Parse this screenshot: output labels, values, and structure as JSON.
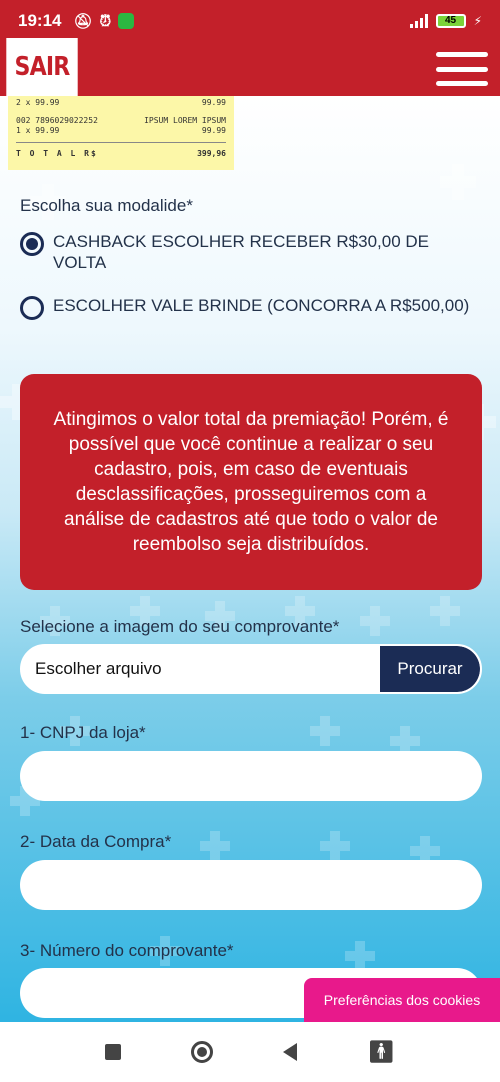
{
  "status_bar": {
    "time": "19:14",
    "battery": "45"
  },
  "header": {
    "logo_text": "SAIR",
    "brand_color": "#c3202a"
  },
  "receipt": {
    "row1_left": "2 x 99.99",
    "row1_right": "99.99",
    "row2_left": "002   7896029022252",
    "row2_right": "IPSUM LOREM IPSUM",
    "row3_left": "1 x 99.99",
    "row3_right": "99.99",
    "total_label": "T O T A L   R$",
    "total_value": "399,96"
  },
  "modalidade": {
    "label": "Escolha sua modalide*",
    "options": [
      {
        "label": "CASHBACK ESCOLHER RECEBER R$30,00 DE VOLTA",
        "checked": true
      },
      {
        "label": "ESCOLHER VALE BRINDE (CONCORRA A R$500,00)",
        "checked": false
      }
    ]
  },
  "alert": {
    "text": "Atingimos o valor total da premiação! Porém, é possível que você continue a realizar o seu cadastro, pois, em caso de eventuais desclassificações, prosseguiremos com a análise de cadastros até que todo o valor de reembolso seja distribuídos."
  },
  "form": {
    "file_label": "Selecione a imagem do seu comprovante*",
    "file_placeholder": "Escolher arquivo",
    "file_button": "Procurar",
    "cnpj_label": "1- CNPJ da loja*",
    "date_label": "2- Data da Compra*",
    "receipt_number_label": "3- Número do comprovante*"
  },
  "cookie_button": "Preferências dos cookies",
  "colors": {
    "accent_red": "#c3202a",
    "navy": "#1b2c55",
    "cookie_pink": "#e8198b"
  }
}
